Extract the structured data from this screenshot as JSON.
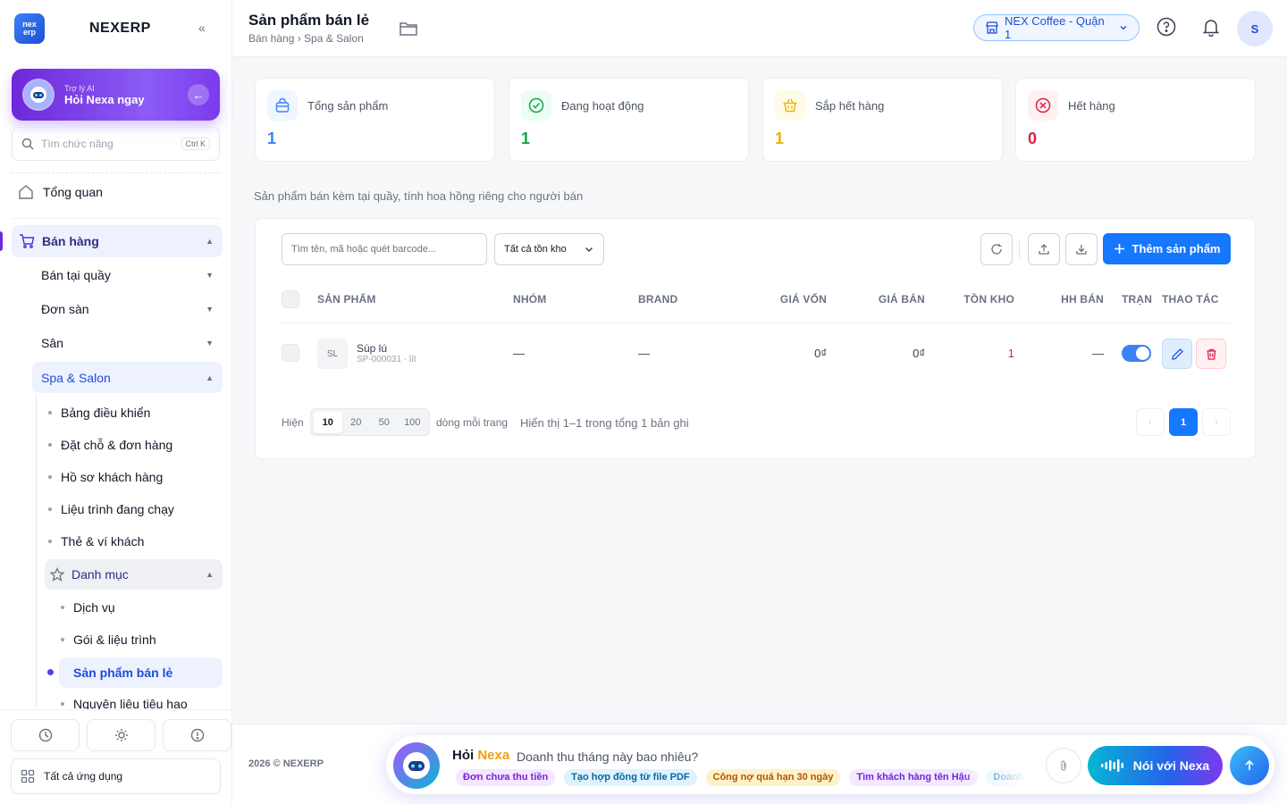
{
  "app": {
    "name": "NEXERP",
    "logo_top": "nex",
    "logo_bottom": "erp"
  },
  "ai_card": {
    "small": "Trợ lý AI",
    "title": "Hỏi Nexa ngay"
  },
  "sidebar": {
    "search_placeholder": "Tìm chức năng",
    "search_shortcut": "Ctrl K",
    "overview": "Tổng quan",
    "sales": "Bán hàng",
    "sales_items": [
      "Bán tại quầy",
      "Đơn sàn",
      "Sân",
      "Spa & Salon"
    ],
    "spa_items": [
      "Bảng điều khiển",
      "Đặt chỗ & đơn hàng",
      "Hồ sơ khách hàng",
      "Liệu trình đang chạy",
      "Thẻ & ví khách"
    ],
    "catalog": "Danh mục",
    "catalog_items": [
      "Dịch vụ",
      "Gói & liệu trình",
      "Sản phẩm bán lẻ",
      "Nguyên liệu tiêu hao"
    ],
    "all_apps": "Tất cả ứng dụng"
  },
  "header": {
    "title": "Sản phẩm bán lẻ",
    "breadcrumb": "Bán hàng › Spa & Salon",
    "store": "NEX Coffee - Quận 1",
    "avatar": "S"
  },
  "stats": [
    {
      "label": "Tổng sản phẩm",
      "value": "1",
      "color": "#3b82f6"
    },
    {
      "label": "Đang hoạt động",
      "value": "1",
      "color": "#16a34a"
    },
    {
      "label": "Sắp hết hàng",
      "value": "1",
      "color": "#eab308"
    },
    {
      "label": "Hết hàng",
      "value": "0",
      "color": "#e11d48"
    }
  ],
  "hint": "Sản phẩm bán kèm tại quầy, tính hoa hồng riêng cho người bán",
  "toolbar": {
    "search_placeholder": "Tìm tên, mã hoặc quét barcode...",
    "stock_filter": "Tất cả tồn kho",
    "add_label": "Thêm sản phẩm"
  },
  "table": {
    "columns": [
      "SẢN PHẨM",
      "NHÓM",
      "BRAND",
      "GIÁ VỐN",
      "GIÁ BÁN",
      "TỒN KHO",
      "HH BÁN",
      "TRẠNG",
      "THAO TÁC"
    ],
    "rows": [
      {
        "thumb": "SL",
        "name": "Súp lú",
        "sku": "SP-000031 · lít",
        "group": "—",
        "brand": "—",
        "cost": "0₫",
        "price": "0₫",
        "stock": "1",
        "commission": "—",
        "active": true
      }
    ]
  },
  "pagination": {
    "show_label": "Hiện",
    "sizes": [
      "10",
      "20",
      "50",
      "100"
    ],
    "selected_size": "10",
    "per_page_label": "dòng mỗi trang",
    "summary": "Hiển thị 1–1 trong tổng 1 bản ghi",
    "current_page": "1",
    "prev": "‹",
    "next": "›"
  },
  "footer": {
    "copyright": "2026 © NEXERP"
  },
  "nexa": {
    "title_prefix": "Hỏi",
    "title_name": "Nexa",
    "question": "Doanh thu tháng này bao nhiêu?",
    "suggestions": [
      "Đơn chưa thu tiền",
      "Tạo hợp đồng từ file PDF",
      "Công nợ quá hạn 30 ngày",
      "Tìm khách hàng tên Hậu",
      "Doanh thu"
    ],
    "talk_label": "Nói với Nexa"
  }
}
